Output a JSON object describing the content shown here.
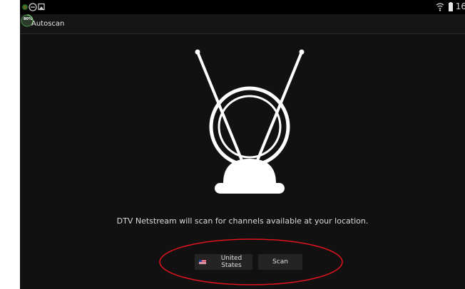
{
  "statusbar": {
    "icons_left": [
      "app-dot-icon",
      "minus-circle-icon",
      "image-icon"
    ],
    "icons_right": [
      "wifi-icon",
      "battery-icon"
    ],
    "time": "16"
  },
  "actionbar": {
    "app_icon_percent": "80%",
    "title": "Autoscan"
  },
  "main": {
    "illustration": "antenna-icon",
    "message": "DTV Netstream will scan for channels available at your location.",
    "location_button": {
      "label": "United States",
      "flag_icon": "us-flag-icon"
    },
    "scan_button": {
      "label": "Scan"
    }
  },
  "annotation": {
    "highlight_color": "#e0141e"
  },
  "colors": {
    "background": "#111111",
    "statusbar": "#000000",
    "button": "#242424",
    "text": "#dcdcdc"
  }
}
